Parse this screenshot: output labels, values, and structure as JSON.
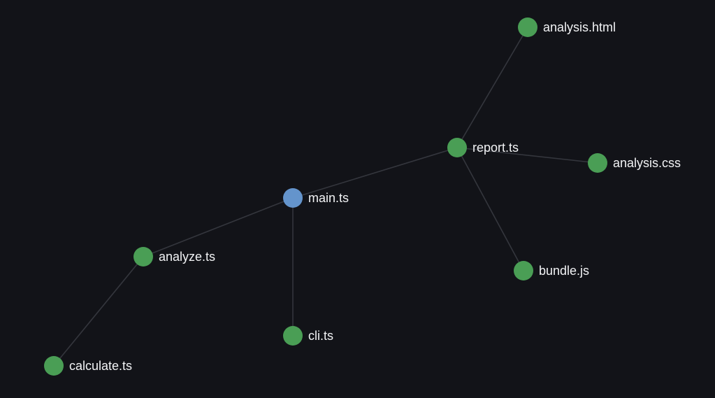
{
  "colors": {
    "background": "#121318",
    "edge": "#34363d",
    "entry_node": "#6494cc",
    "file_node": "#4a9e55",
    "label": "#f2f3f5"
  },
  "graph": {
    "nodes": [
      {
        "id": "main",
        "label": "main.ts",
        "kind": "entry"
      },
      {
        "id": "analyze",
        "label": "analyze.ts",
        "kind": "file"
      },
      {
        "id": "calculate",
        "label": "calculate.ts",
        "kind": "file"
      },
      {
        "id": "cli",
        "label": "cli.ts",
        "kind": "file"
      },
      {
        "id": "report",
        "label": "report.ts",
        "kind": "file"
      },
      {
        "id": "analysis-html",
        "label": "analysis.html",
        "kind": "file"
      },
      {
        "id": "analysis-css",
        "label": "analysis.css",
        "kind": "file"
      },
      {
        "id": "bundle",
        "label": "bundle.js",
        "kind": "file"
      }
    ],
    "edges": [
      {
        "from": "main",
        "to": "report"
      },
      {
        "from": "main",
        "to": "analyze"
      },
      {
        "from": "main",
        "to": "cli"
      },
      {
        "from": "analyze",
        "to": "calculate"
      },
      {
        "from": "report",
        "to": "analysis-html"
      },
      {
        "from": "report",
        "to": "analysis-css"
      },
      {
        "from": "report",
        "to": "bundle"
      }
    ]
  }
}
